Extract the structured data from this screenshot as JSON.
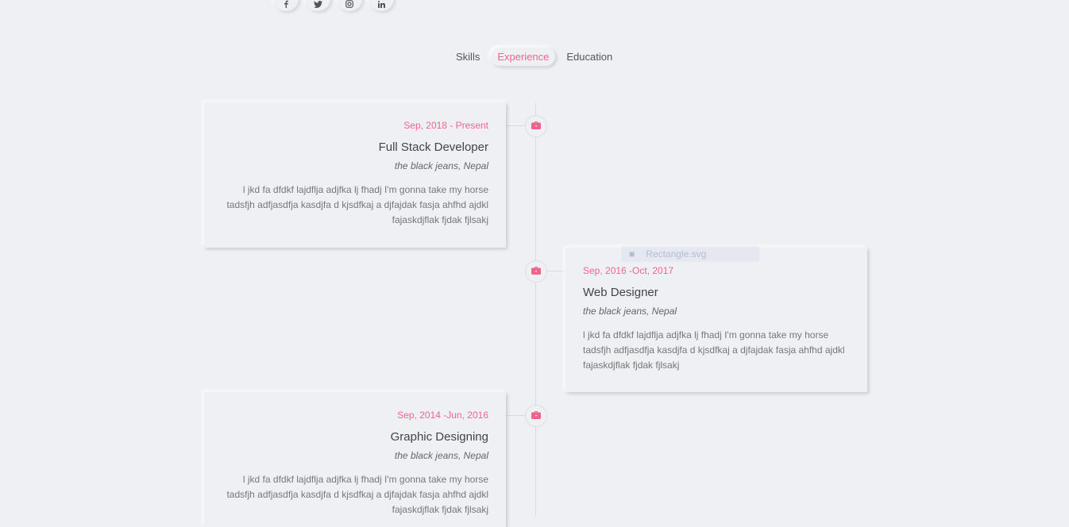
{
  "social": {
    "items": [
      {
        "icon": "facebook-icon"
      },
      {
        "icon": "twitter-icon"
      },
      {
        "icon": "instagram-icon"
      },
      {
        "icon": "linkedin-icon"
      }
    ]
  },
  "tabs": [
    {
      "label": "Skills",
      "active": false
    },
    {
      "label": "Experience",
      "active": true
    },
    {
      "label": "Education",
      "active": false
    }
  ],
  "colors": {
    "accent": "#f0648c",
    "background": "#eff0f4",
    "line": "#d9dadf"
  },
  "timeline": [
    {
      "date": "Sep, 2018 - Present",
      "title": "Full Stack Developer",
      "company": "the black jeans, Nepal",
      "description": "l jkd fa dfdkf lajdflja adjfka lj fhadj I'm gonna take my horse tadsfjh adfjasdfja kasdjfa d kjsdfkaj a djfajdak fasja ahfhd ajdkl fajaskdjflak fjdak fjlsakj",
      "icon": "briefcase-icon"
    },
    {
      "date": "Sep, 2016 -Oct, 2017",
      "title": "Web Designer",
      "company": "the black jeans, Nepal",
      "description": "l jkd fa dfdkf lajdflja adjfka lj fhadj I'm gonna take my horse tadsfjh adfjasdfja kasdjfa d kjsdfkaj a djfajdak fasja ahfhd ajdkl fajaskdjflak fjdak fjlsakj",
      "icon": "briefcase-icon"
    },
    {
      "date": "Sep, 2014 -Jun, 2016",
      "title": "Graphic Designing",
      "company": "the black jeans, Nepal",
      "description": "l jkd fa dfdkf lajdflja adjfka lj fhadj I'm gonna take my horse tadsfjh adfjasdfja kasdjfa d kjsdfkaj a djfajdak fasja ahfhd ajdkl fajaskdjflak fjdak fjlsakj",
      "icon": "briefcase-icon"
    }
  ],
  "overlay": {
    "label": "Rectangle.svg"
  }
}
